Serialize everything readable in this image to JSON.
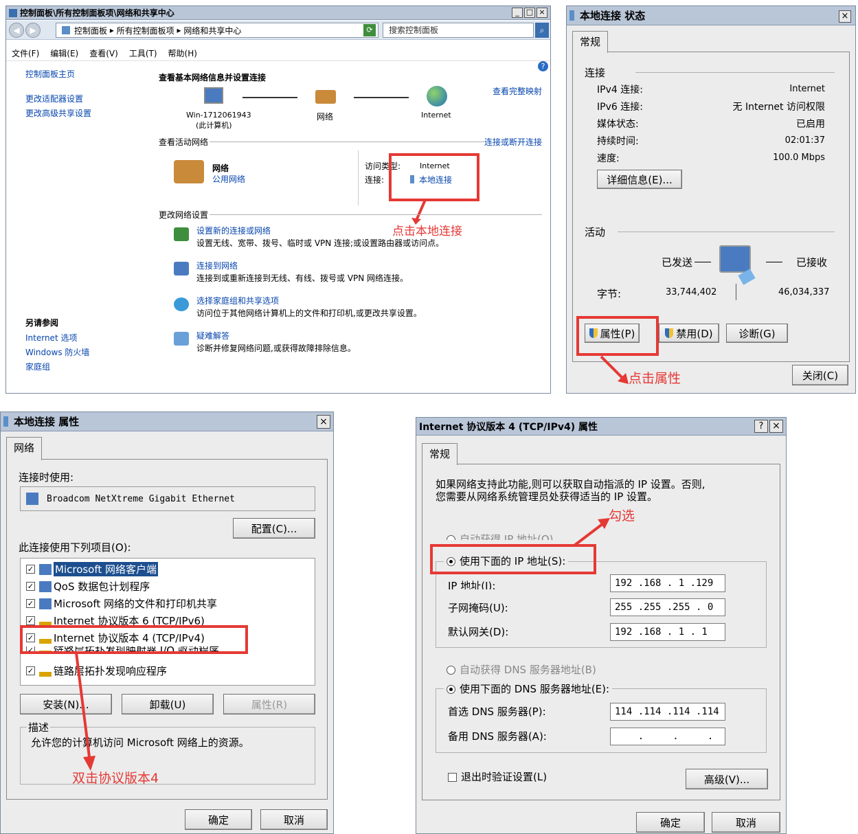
{
  "cp": {
    "title": "控制面板\\所有控制面板项\\网络和共享中心",
    "breadcrumb": [
      "控制面板",
      "所有控制面板项",
      "网络和共享中心"
    ],
    "search_placeholder": "搜索控制面板",
    "menu": [
      "文件(F)",
      "编辑(E)",
      "查看(V)",
      "工具(T)",
      "帮助(H)"
    ],
    "side_links": [
      "控制面板主页",
      "更改适配器设置",
      "更改高级共享设置"
    ],
    "see_also_title": "另请参阅",
    "see_also": [
      "Internet 选项",
      "Windows 防火墙",
      "家庭组"
    ],
    "heading": "查看基本网络信息并设置连接",
    "view_full_map": "查看完整映射",
    "map": {
      "computer": "Win-1712061943",
      "computer_sub": "(此计算机)",
      "network": "网络",
      "internet": "Internet"
    },
    "active_title": "查看活动网络",
    "connect_link": "连接或断开连接",
    "net_name": "网络",
    "net_type": "公用网络",
    "access_label": "访问类型:",
    "access_value": "Internet",
    "conn_label": "连接:",
    "conn_value": "本地连接",
    "change_title": "更改网络设置",
    "tasks": [
      {
        "link": "设置新的连接或网络",
        "desc": "设置无线、宽带、拨号、临时或 VPN 连接;或设置路由器或访问点。"
      },
      {
        "link": "连接到网络",
        "desc": "连接到或重新连接到无线、有线、拨号或 VPN 网络连接。"
      },
      {
        "link": "选择家庭组和共享选项",
        "desc": "访问位于其他网络计算机上的文件和打印机,或更改共享设置。"
      },
      {
        "link": "疑难解答",
        "desc": "诊断并修复网络问题,或获得故障排除信息。"
      }
    ],
    "annotation": "点击本地连接"
  },
  "status": {
    "title": "本地连接 状态",
    "tab": "常规",
    "conn_group": "连接",
    "rows": [
      {
        "k": "IPv4 连接:",
        "v": "Internet"
      },
      {
        "k": "IPv6 连接:",
        "v": "无 Internet 访问权限"
      },
      {
        "k": "媒体状态:",
        "v": "已启用"
      },
      {
        "k": "持续时间:",
        "v": "02:01:37"
      },
      {
        "k": "速度:",
        "v": "100.0 Mbps"
      }
    ],
    "details_btn": "详细信息(E)...",
    "activity_group": "活动",
    "sent": "已发送",
    "received": "已接收",
    "bytes_label": "字节:",
    "bytes_sent": "33,744,402",
    "bytes_recv": "46,034,337",
    "prop_btn": "属性(P)",
    "disable_btn": "禁用(D)",
    "diag_btn": "诊断(G)",
    "close_btn": "关闭(C)",
    "annotation": "点击属性"
  },
  "props": {
    "title": "本地连接 属性",
    "tab": "网络",
    "connect_using": "连接时使用:",
    "adapter": "Broadcom NetXtreme Gigabit Ethernet",
    "config_btn": "配置(C)...",
    "items_label": "此连接使用下列项目(O):",
    "items": [
      "Microsoft 网络客户端",
      "QoS 数据包计划程序",
      "Microsoft 网络的文件和打印机共享",
      "Internet 协议版本 6 (TCP/IPv6)",
      "Internet 协议版本 4 (TCP/IPv4)",
      "链路层拓扑发现映射器 I/O 驱动程序",
      "链路层拓扑发现响应程序"
    ],
    "install_btn": "安装(N)...",
    "uninstall_btn": "卸载(U)",
    "prop_btn": "属性(R)",
    "desc_title": "描述",
    "desc_text": "允许您的计算机访问 Microsoft 网络上的资源。",
    "ok_btn": "确定",
    "cancel_btn": "取消",
    "annotation": "双击协议版本4"
  },
  "ipv4": {
    "title": "Internet 协议版本 4 (TCP/IPv4) 属性",
    "tab": "常规",
    "intro1": "如果网络支持此功能,则可以获取自动指派的 IP 设置。否则,",
    "intro2": "您需要从网络系统管理员处获得适当的 IP 设置。",
    "auto_ip": "自动获得 IP 地址(O)",
    "manual_ip": "使用下面的 IP 地址(S):",
    "ip_label": "IP 地址(I):",
    "ip_value": "192 .168 . 1 .129",
    "mask_label": "子网掩码(U):",
    "mask_value": "255 .255 .255 . 0",
    "gw_label": "默认网关(D):",
    "gw_value": "192 .168 . 1 . 1",
    "auto_dns": "自动获得 DNS 服务器地址(B)",
    "manual_dns": "使用下面的 DNS 服务器地址(E):",
    "dns1_label": "首选 DNS 服务器(P):",
    "dns1_value": "114 .114 .114 .114",
    "dns2_label": "备用 DNS 服务器(A):",
    "dns2_value": "    .     .     .",
    "validate": "退出时验证设置(L)",
    "advanced_btn": "高级(V)...",
    "ok_btn": "确定",
    "cancel_btn": "取消",
    "annotation": "勾选"
  },
  "colors": {
    "annotation": "#e53935",
    "link": "#0645ad"
  }
}
